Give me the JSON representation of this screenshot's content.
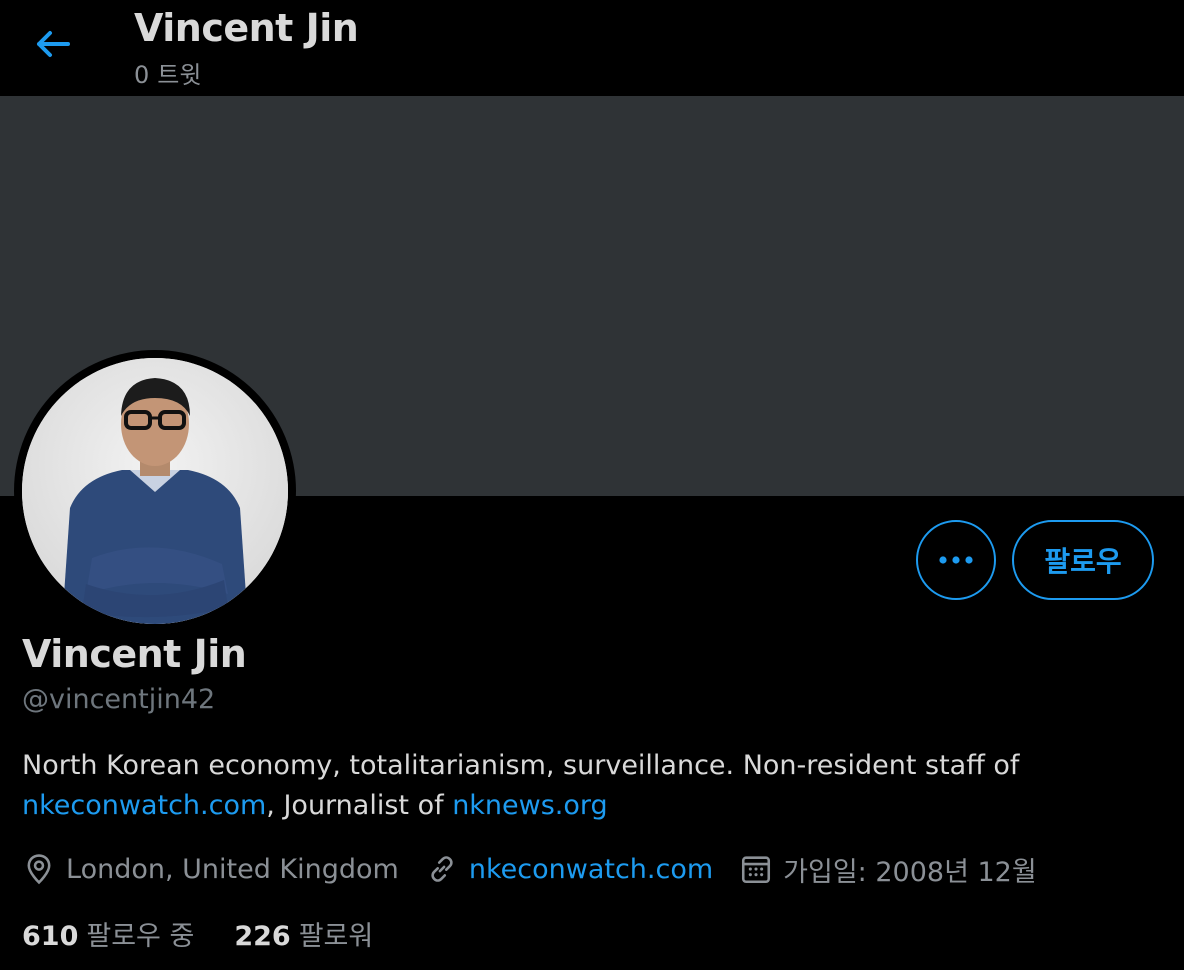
{
  "header": {
    "title": "Vincent Jin",
    "tweet_count": "0",
    "tweet_label": "트윗"
  },
  "profile": {
    "name": "Vincent Jin",
    "handle": "@vincentjin42",
    "bio_text_1": "North Korean economy, totalitarianism, surveillance. Non-resident staff of ",
    "bio_link_1": "nkeconwatch.com",
    "bio_text_2": ", Journalist of ",
    "bio_link_2": "nknews.org",
    "location": "London, United Kingdom",
    "website": "nkeconwatch.com",
    "joined": "가입일: 2008년 12월"
  },
  "actions": {
    "follow_label": "팔로우"
  },
  "stats": {
    "following_count": "610",
    "following_label": "팔로우 중",
    "followers_count": "226",
    "followers_label": "팔로워"
  },
  "colors": {
    "accent": "#1d9bf0",
    "background": "#000000",
    "banner": "#2f3336",
    "muted_text": "#8b9096"
  },
  "icons": [
    "back-arrow-icon",
    "more-dots-icon",
    "location-pin-icon",
    "link-icon",
    "calendar-icon"
  ]
}
